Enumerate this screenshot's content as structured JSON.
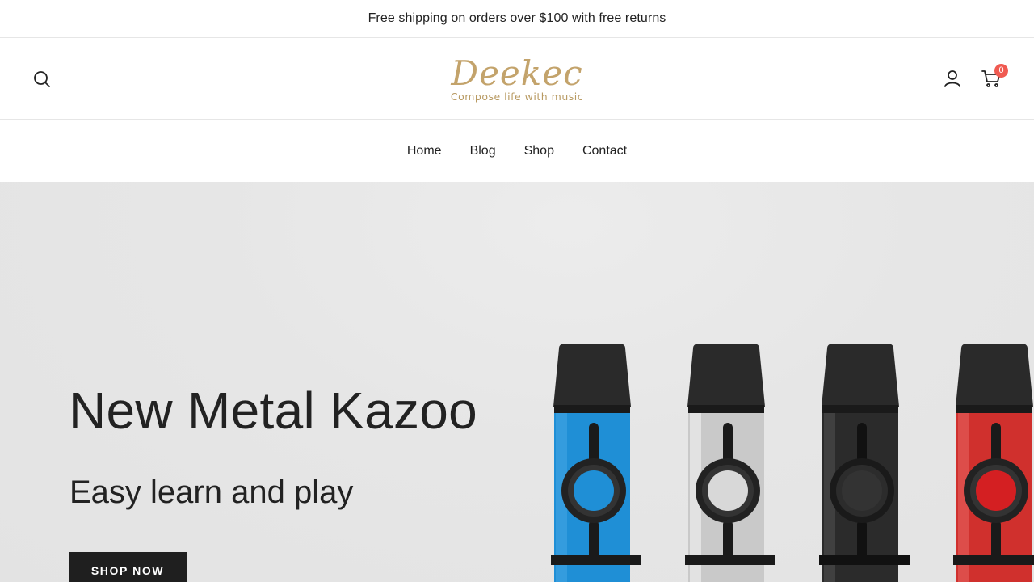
{
  "announcement": {
    "text": "Free shipping on orders over $100 with free returns"
  },
  "header": {
    "logo": {
      "wordmark": "Deekec",
      "tagline": "Compose life with music",
      "color": "#c3a36b"
    },
    "icons": {
      "search": "search-icon",
      "account": "user-icon",
      "cart": "cart-icon"
    },
    "cart_count": "0",
    "badge_color": "#f05a51"
  },
  "nav": {
    "items": [
      {
        "label": "Home"
      },
      {
        "label": "Blog"
      },
      {
        "label": "Shop"
      },
      {
        "label": "Contact"
      }
    ]
  },
  "hero": {
    "title": "New Metal Kazoo",
    "subtitle": "Easy learn and play",
    "cta_label": "SHOP NOW",
    "background": "#e6e6e6",
    "product_colors": [
      "#1f8fd6",
      "#c9c9c9",
      "#2b2b2b",
      "#d0302d"
    ]
  }
}
